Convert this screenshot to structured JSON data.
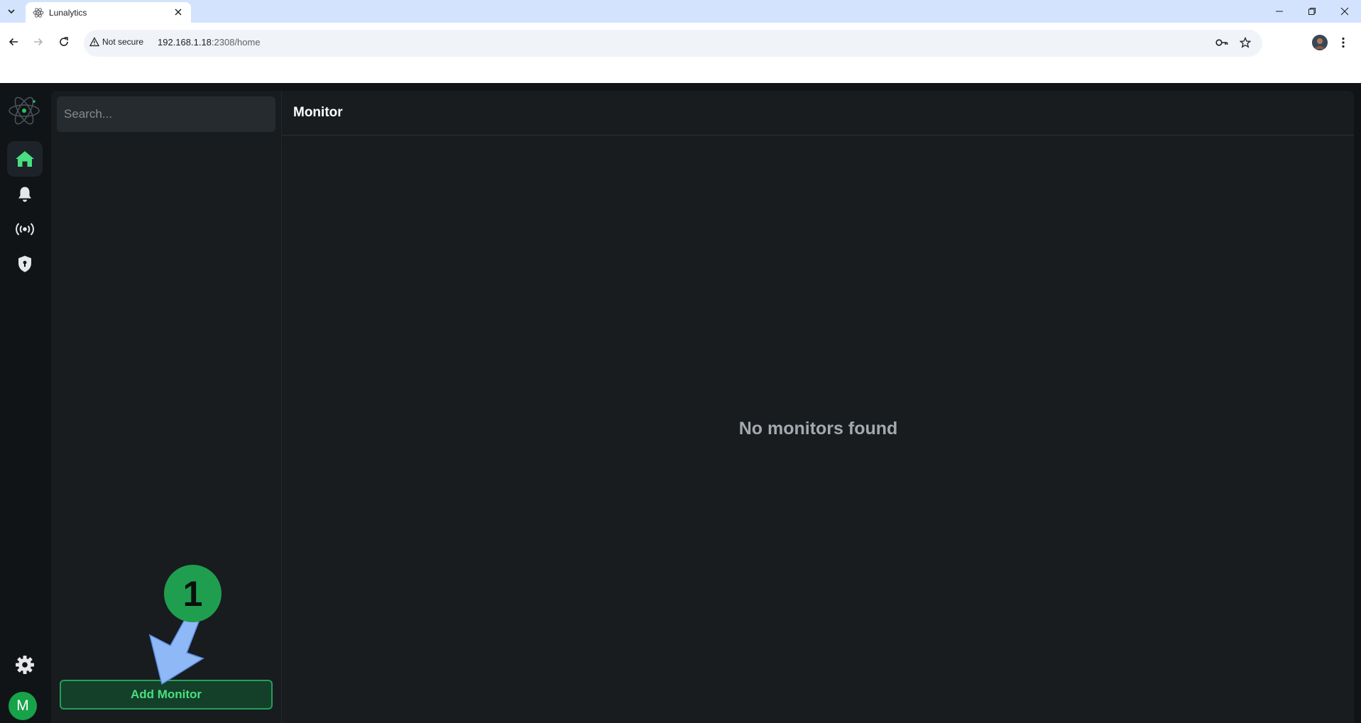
{
  "browser": {
    "tab_title": "Lunalytics",
    "not_secure_label": "Not secure",
    "url_host": "192.168.1.18",
    "url_rest": ":2308/home"
  },
  "app": {
    "search": {
      "placeholder": "Search..."
    },
    "add_button_label": "Add Monitor",
    "avatar_initial": "M",
    "main": {
      "title": "Monitor",
      "empty_message": "No monitors found"
    },
    "rail_items": [
      "home-icon",
      "bell-icon",
      "broadcast-icon",
      "shield-icon"
    ],
    "colors": {
      "accent": "#22c55e",
      "background": "#111416",
      "panel": "#181c1f"
    }
  },
  "annotation": {
    "step_number": "1"
  }
}
